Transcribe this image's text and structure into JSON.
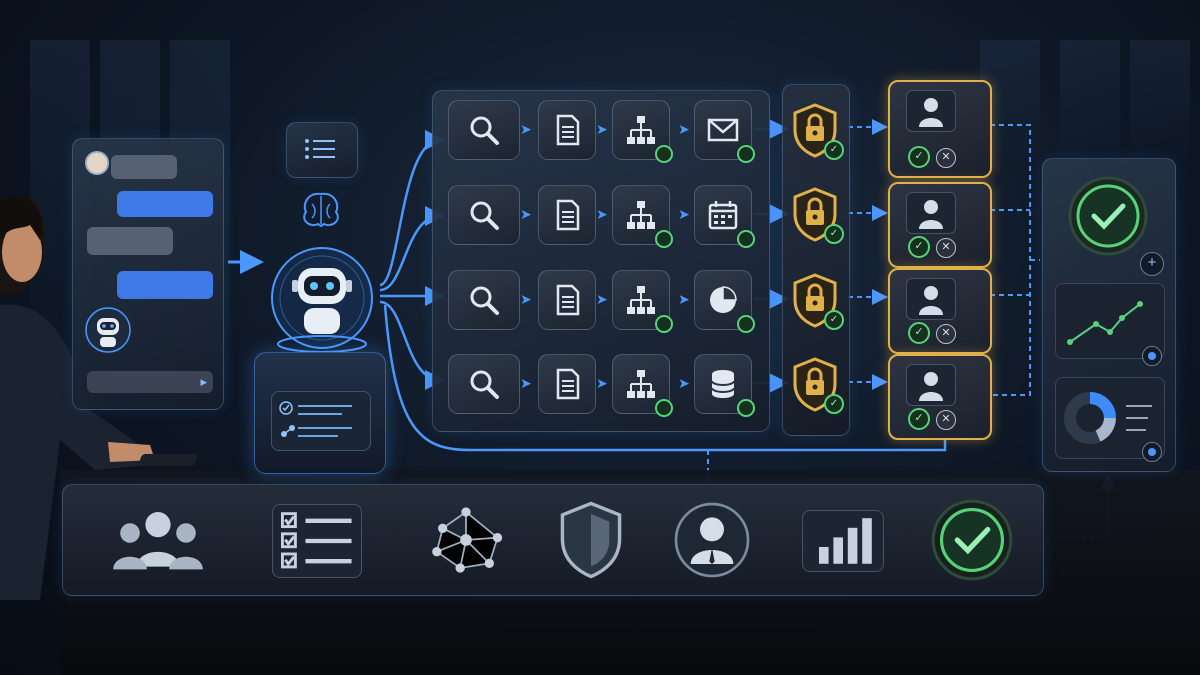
{
  "scene": {
    "palette": {
      "accent_blue": "#3d8bff",
      "approval_gold": "#e0b04a",
      "success_green": "#56d37a",
      "reject_grey": "#b8c2cf"
    }
  },
  "chat_panel": {
    "icons": [
      "user-avatar-icon",
      "bot-avatar-icon",
      "send-arrow-icon"
    ]
  },
  "agent_hub": {
    "icons": [
      "checklist-icon",
      "brain-icon",
      "robot-icon",
      "task-list-icon"
    ]
  },
  "workflow_rows": [
    {
      "steps": [
        "search-icon",
        "document-icon",
        "hierarchy-icon",
        "mail-icon"
      ]
    },
    {
      "steps": [
        "search-icon",
        "document-icon",
        "hierarchy-icon",
        "calendar-icon"
      ]
    },
    {
      "steps": [
        "search-icon",
        "document-icon",
        "hierarchy-icon",
        "pie-chart-icon"
      ]
    },
    {
      "steps": [
        "search-icon",
        "document-icon",
        "hierarchy-icon",
        "database-icon"
      ]
    }
  ],
  "security_gates": {
    "count": 4,
    "icon": "shield-lock-icon"
  },
  "human_review": {
    "count": 4,
    "icons": [
      "reviewer-icon",
      "approve-icon",
      "reject-icon"
    ]
  },
  "results_panel": {
    "icons": [
      "success-check-icon",
      "trend-line-icon",
      "donut-chart-icon"
    ]
  },
  "pipeline": {
    "stages": [
      "team-icon",
      "checklist-icon",
      "network-icon",
      "shield-icon",
      "reviewer-icon",
      "bar-chart-icon",
      "success-check-icon"
    ]
  }
}
